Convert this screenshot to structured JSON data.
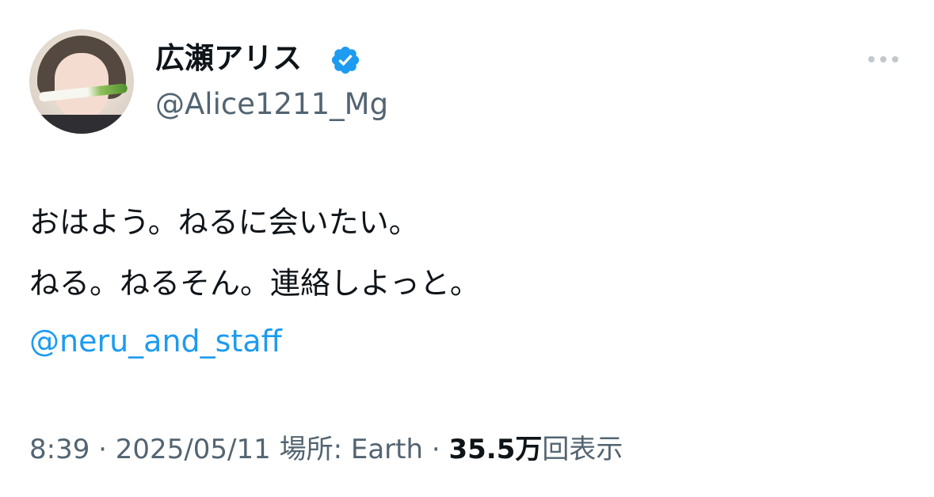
{
  "author": {
    "display_name": "広瀬アリス",
    "handle": "@Alice1211_Mg",
    "verified": true,
    "verified_color": "#1d9bf0",
    "avatar_icon": "avatar-photo"
  },
  "more_icon": "ellipsis-icon",
  "tweet": {
    "lines": [
      "おはよう。ねるに会いたい。",
      "ねる。ねるそん。連絡しよっと。"
    ],
    "mention": "@neru_and_staff",
    "mention_color": "#1d9bf0"
  },
  "meta": {
    "time": "8:39",
    "separator": " · ",
    "date": "2025/05/11",
    "location_label": "場所: Earth",
    "views_count": "35.5万",
    "views_label": "回表示"
  }
}
